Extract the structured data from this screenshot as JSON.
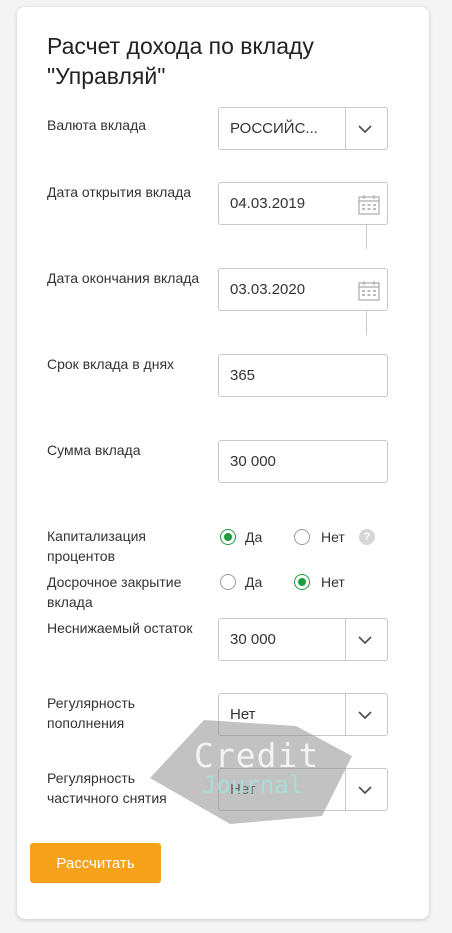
{
  "title": "Расчет дохода по вкладу \"Управляй\"",
  "currency": {
    "label": "Валюта вклада",
    "value": "РОССИЙС..."
  },
  "open_date": {
    "label": "Дата открытия вклада",
    "value": "04.03.2019"
  },
  "close_date": {
    "label": "Дата окончания вклада",
    "value": "03.03.2020"
  },
  "term": {
    "label": "Срок вклада в днях",
    "value": "365"
  },
  "amount": {
    "label": "Сумма вклада",
    "value": "30 000"
  },
  "capitalization": {
    "label": "Капитализация процентов",
    "option_yes": "Да",
    "option_no": "Нет",
    "selected": "Да",
    "help": "?"
  },
  "early_close": {
    "label": "Досрочное закрытие вклада",
    "option_yes": "Да",
    "option_no": "Нет",
    "selected": "Нет"
  },
  "min_balance": {
    "label": "Неснижаемый остаток",
    "value": "30 000"
  },
  "replenishment": {
    "label": "Регулярность пополнения",
    "value": "Нет"
  },
  "withdrawal": {
    "label": "Регулярность частичного снятия",
    "value": "Нет"
  },
  "calculate_button": "Рассчитать",
  "watermark": {
    "line1": "Credit",
    "line2": "Journal"
  },
  "colors": {
    "accent": "#f7a21b",
    "radio": "#1e9b3b",
    "border": "#c8c8c8"
  }
}
